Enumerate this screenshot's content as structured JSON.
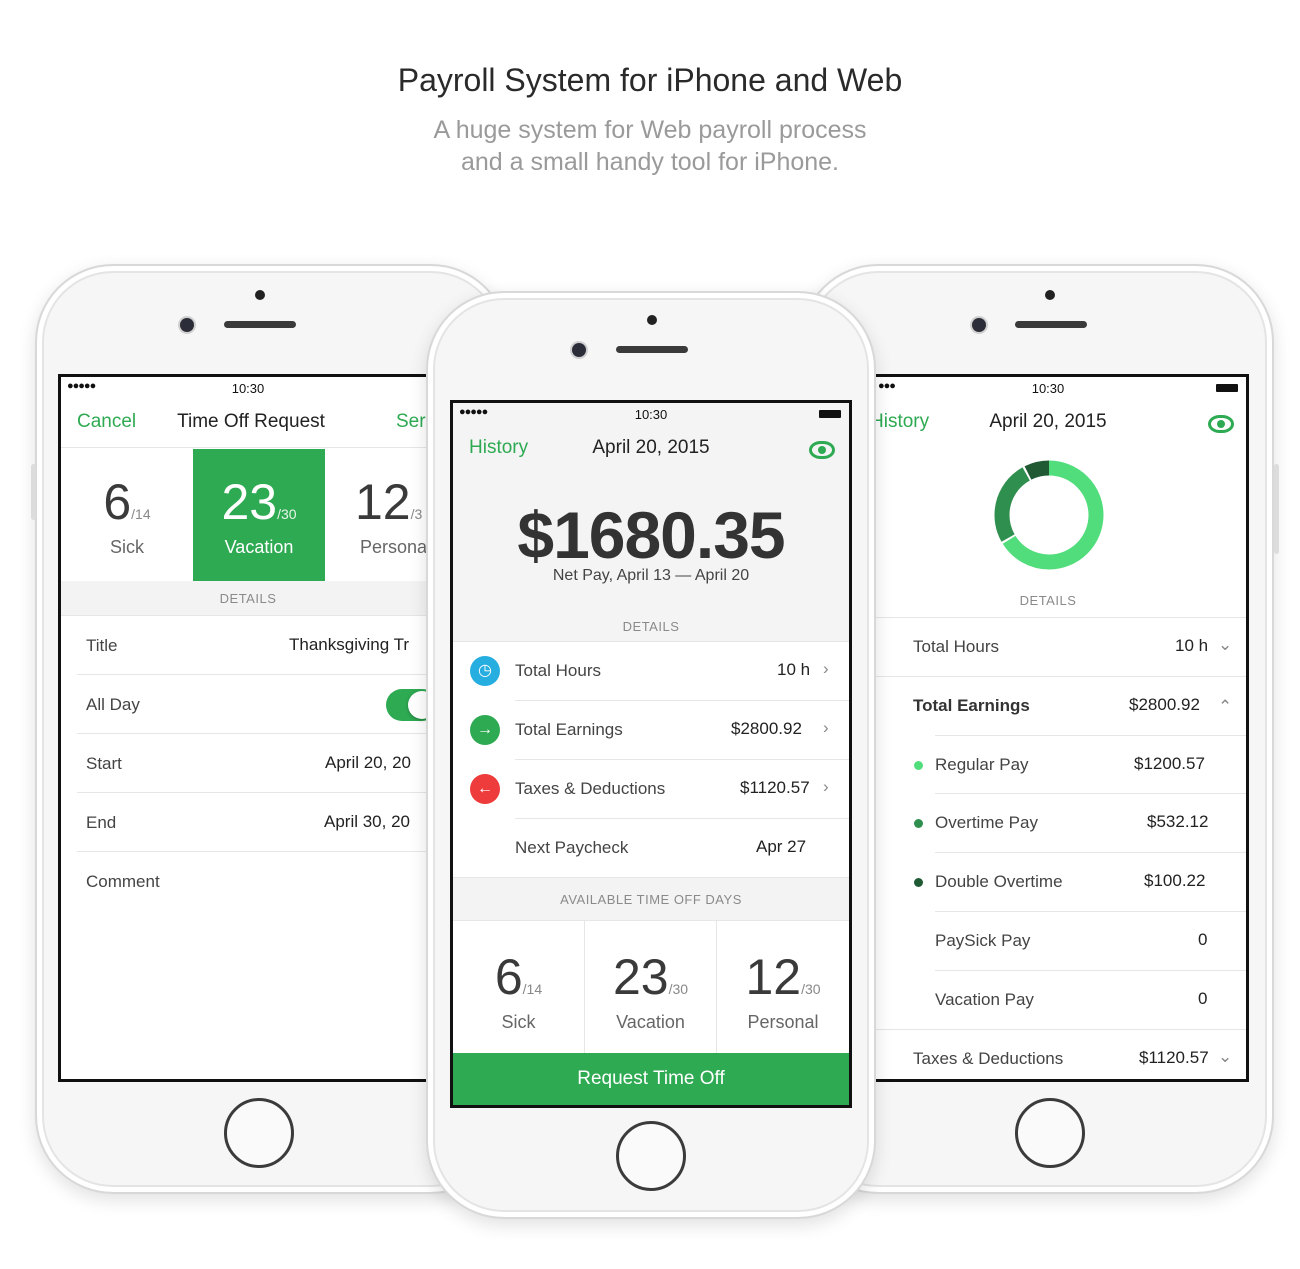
{
  "header": {
    "title": "Payroll System for iPhone and Web",
    "subtitle_line1": "A huge system for Web payroll process",
    "subtitle_line2": "and a small handy tool for iPhone."
  },
  "colors": {
    "accent": "#2eaa52",
    "blue": "#27aee0",
    "red": "#ee3b3b",
    "dark_green": "#1f5a34"
  },
  "status_time": "10:30",
  "left_phone": {
    "nav": {
      "cancel": "Cancel",
      "title": "Time Off Request",
      "send": "Ser"
    },
    "time_off": [
      {
        "num": "6",
        "total": "/14",
        "label": "Sick"
      },
      {
        "num": "23",
        "total": "/30",
        "label": "Vacation"
      },
      {
        "num": "12",
        "total": "/3",
        "label": "Persona"
      }
    ],
    "details_label": "DETAILS",
    "rows": [
      {
        "label": "Title",
        "value": "Thanksgiving Tr"
      },
      {
        "label": "All Day",
        "value": ""
      },
      {
        "label": "Start",
        "value": "April 20, 20"
      },
      {
        "label": "End",
        "value": "April 30, 20"
      },
      {
        "label": "Comment",
        "value": ""
      }
    ]
  },
  "center_phone": {
    "nav": {
      "history": "History",
      "date": "April 20, 2015"
    },
    "amount": "$1680.35",
    "net_pay": "Net Pay, April 13 — April 20",
    "details_label": "DETAILS",
    "rows": [
      {
        "icon": "clock-icon",
        "label": "Total Hours",
        "value": "10 h"
      },
      {
        "icon": "arrow-right-icon",
        "label": "Total Earnings",
        "value": "$2800.92"
      },
      {
        "icon": "arrow-left-icon",
        "label": "Taxes & Deductions",
        "value": "$1120.57"
      },
      {
        "icon": "",
        "label": "Next Paycheck",
        "value": "Apr 27"
      }
    ],
    "available_label": "AVAILABLE TIME OFF DAYS",
    "time_off": [
      {
        "num": "6",
        "total": "/14",
        "label": "Sick"
      },
      {
        "num": "23",
        "total": "/30",
        "label": "Vacation"
      },
      {
        "num": "12",
        "total": "/30",
        "label": "Personal"
      }
    ],
    "request_button": "Request Time Off"
  },
  "right_phone": {
    "nav": {
      "history": "History",
      "date": "April 20, 2015"
    },
    "details_label": "DETAILS",
    "rows": [
      {
        "label": "Total Hours",
        "value": "10 h"
      },
      {
        "label": "Total Earnings",
        "value": "$2800.92"
      },
      {
        "label": "Regular Pay",
        "value": "$1200.57"
      },
      {
        "label": "Overtime Pay",
        "value": "$532.12"
      },
      {
        "label": "Double Overtime",
        "value": "$100.22"
      },
      {
        "label": "PaySick Pay",
        "value": "0"
      },
      {
        "label": "Vacation Pay",
        "value": "0"
      },
      {
        "label": "Taxes & Deductions",
        "value": "$1120.57"
      }
    ]
  }
}
